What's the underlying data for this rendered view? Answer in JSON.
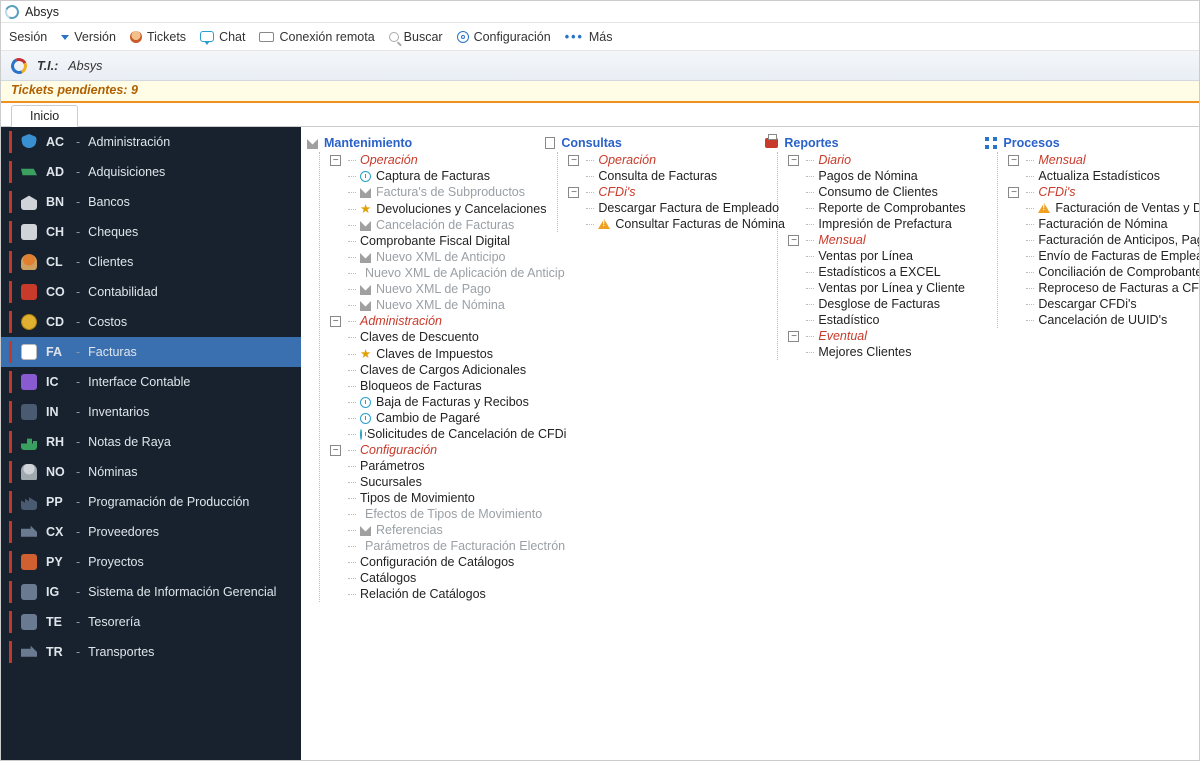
{
  "app": {
    "title": "Absys"
  },
  "menu": {
    "items": [
      {
        "label": "Sesión",
        "icon": ""
      },
      {
        "label": "Versión",
        "icon": "download"
      },
      {
        "label": "Tickets",
        "icon": "head"
      },
      {
        "label": "Chat",
        "icon": "chat"
      },
      {
        "label": "Conexión remota",
        "icon": "monitor"
      },
      {
        "label": "Buscar",
        "icon": "search"
      },
      {
        "label": "Configuración",
        "icon": "gear"
      },
      {
        "label": "Más",
        "icon": "dots"
      }
    ]
  },
  "header": {
    "label": "T.I.:",
    "value": "Absys"
  },
  "notice": "Tickets pendientes: 9",
  "tab": {
    "label": "Inicio"
  },
  "sidebar": {
    "items": [
      {
        "code": "AC",
        "name": "Administración",
        "icon": "shield"
      },
      {
        "code": "AD",
        "name": "Adquisiciones",
        "icon": "cart"
      },
      {
        "code": "BN",
        "name": "Bancos",
        "icon": "bank"
      },
      {
        "code": "CH",
        "name": "Cheques",
        "icon": "cheque"
      },
      {
        "code": "CL",
        "name": "Clientes",
        "icon": "client"
      },
      {
        "code": "CO",
        "name": "Contabilidad",
        "icon": "book"
      },
      {
        "code": "CD",
        "name": "Costos",
        "icon": "coin"
      },
      {
        "code": "FA",
        "name": "Facturas",
        "icon": "invoice",
        "selected": true
      },
      {
        "code": "IC",
        "name": "Interface Contable",
        "icon": "ic"
      },
      {
        "code": "IN",
        "name": "Inventarios",
        "icon": "inv"
      },
      {
        "code": "RH",
        "name": "Notas de Raya",
        "icon": "chart"
      },
      {
        "code": "NO",
        "name": "Nóminas",
        "icon": "person"
      },
      {
        "code": "PP",
        "name": "Programación de Producción",
        "icon": "factory"
      },
      {
        "code": "CX",
        "name": "Proveedores",
        "icon": "truck"
      },
      {
        "code": "PY",
        "name": "Proyectos",
        "icon": "py"
      },
      {
        "code": "IG",
        "name": "Sistema de Información Gerencial",
        "icon": "ig"
      },
      {
        "code": "TE",
        "name": "Tesorería",
        "icon": "te"
      },
      {
        "code": "TR",
        "name": "Transportes",
        "icon": "truck"
      }
    ]
  },
  "sections": {
    "mantenimiento": {
      "title": "Mantenimiento",
      "groups": [
        {
          "title": "Operación",
          "items": [
            {
              "label": "Captura de Facturas",
              "icon": "clock"
            },
            {
              "label": "Factura's de Subproductos",
              "icon": "tool",
              "dim": true
            },
            {
              "label": "Devoluciones y Cancelaciones",
              "icon": "star"
            },
            {
              "label": "Cancelación de Facturas",
              "icon": "tool",
              "dim": true
            },
            {
              "label": "Comprobante Fiscal Digital"
            },
            {
              "label": "Nuevo XML de Anticipo",
              "icon": "tool",
              "dim": true
            },
            {
              "label": "Nuevo XML de Aplicación de Anticip",
              "icon": "tool",
              "dim": true
            },
            {
              "label": "Nuevo XML de Pago",
              "icon": "tool",
              "dim": true
            },
            {
              "label": "Nuevo XML de Nómina",
              "icon": "tool",
              "dim": true
            }
          ]
        },
        {
          "title": "Administración",
          "items": [
            {
              "label": "Claves de Descuento"
            },
            {
              "label": "Claves de Impuestos",
              "icon": "star"
            },
            {
              "label": "Claves de Cargos Adicionales"
            },
            {
              "label": "Bloqueos de Facturas"
            },
            {
              "label": "Baja de Facturas y Recibos",
              "icon": "clock"
            },
            {
              "label": "Cambio de Pagaré",
              "icon": "clock"
            },
            {
              "label": "Solicitudes de Cancelación de CFDi",
              "icon": "clock"
            }
          ]
        },
        {
          "title": "Configuración",
          "items": [
            {
              "label": "Parámetros"
            },
            {
              "label": "Sucursales"
            },
            {
              "label": "Tipos de Movimiento"
            },
            {
              "label": "Efectos de Tipos de Movimiento",
              "icon": "tool",
              "dim": true
            },
            {
              "label": "Referencias",
              "icon": "tool",
              "dim": true
            },
            {
              "label": "Parámetros de Facturación Electrón",
              "icon": "tool",
              "dim": true
            },
            {
              "label": "Configuración de Catálogos"
            },
            {
              "label": "Catálogos"
            },
            {
              "label": "Relación de Catálogos"
            }
          ]
        }
      ]
    },
    "consultas": {
      "title": "Consultas",
      "groups": [
        {
          "title": "Operación",
          "items": [
            {
              "label": "Consulta de Facturas"
            }
          ]
        },
        {
          "title": "CFDi's",
          "items": [
            {
              "label": "Descargar Factura de Empleado"
            },
            {
              "label": "Consultar Facturas de Nómina",
              "icon": "warn"
            }
          ]
        }
      ]
    },
    "reportes": {
      "title": "Reportes",
      "groups": [
        {
          "title": "Diario",
          "items": [
            {
              "label": "Pagos de Nómina"
            },
            {
              "label": "Consumo de Clientes"
            },
            {
              "label": "Reporte de Comprobantes"
            },
            {
              "label": "Impresión de Prefactura"
            }
          ]
        },
        {
          "title": "Mensual",
          "items": [
            {
              "label": "Ventas por Línea"
            },
            {
              "label": "Estadísticos a EXCEL"
            },
            {
              "label": "Ventas por Línea y Cliente"
            },
            {
              "label": "Desglose de Facturas"
            },
            {
              "label": "Estadístico"
            }
          ]
        },
        {
          "title": "Eventual",
          "items": [
            {
              "label": "Mejores Clientes"
            }
          ]
        }
      ]
    },
    "procesos": {
      "title": "Procesos",
      "groups": [
        {
          "title": "Mensual",
          "items": [
            {
              "label": "Actualiza Estadísticos"
            }
          ]
        },
        {
          "title": "CFDi's",
          "items": [
            {
              "label": "Facturación de Ventas y Devolu",
              "icon": "warn"
            },
            {
              "label": "Facturación de Nómina"
            },
            {
              "label": "Facturación de Anticipos, Pago"
            },
            {
              "label": "Envío de Facturas de Emplead"
            },
            {
              "label": "Conciliación de Comprobantes"
            },
            {
              "label": "Reproceso de Facturas a CFDi"
            },
            {
              "label": "Descargar CFDi's"
            },
            {
              "label": "Cancelación de UUID's"
            }
          ]
        }
      ]
    }
  }
}
